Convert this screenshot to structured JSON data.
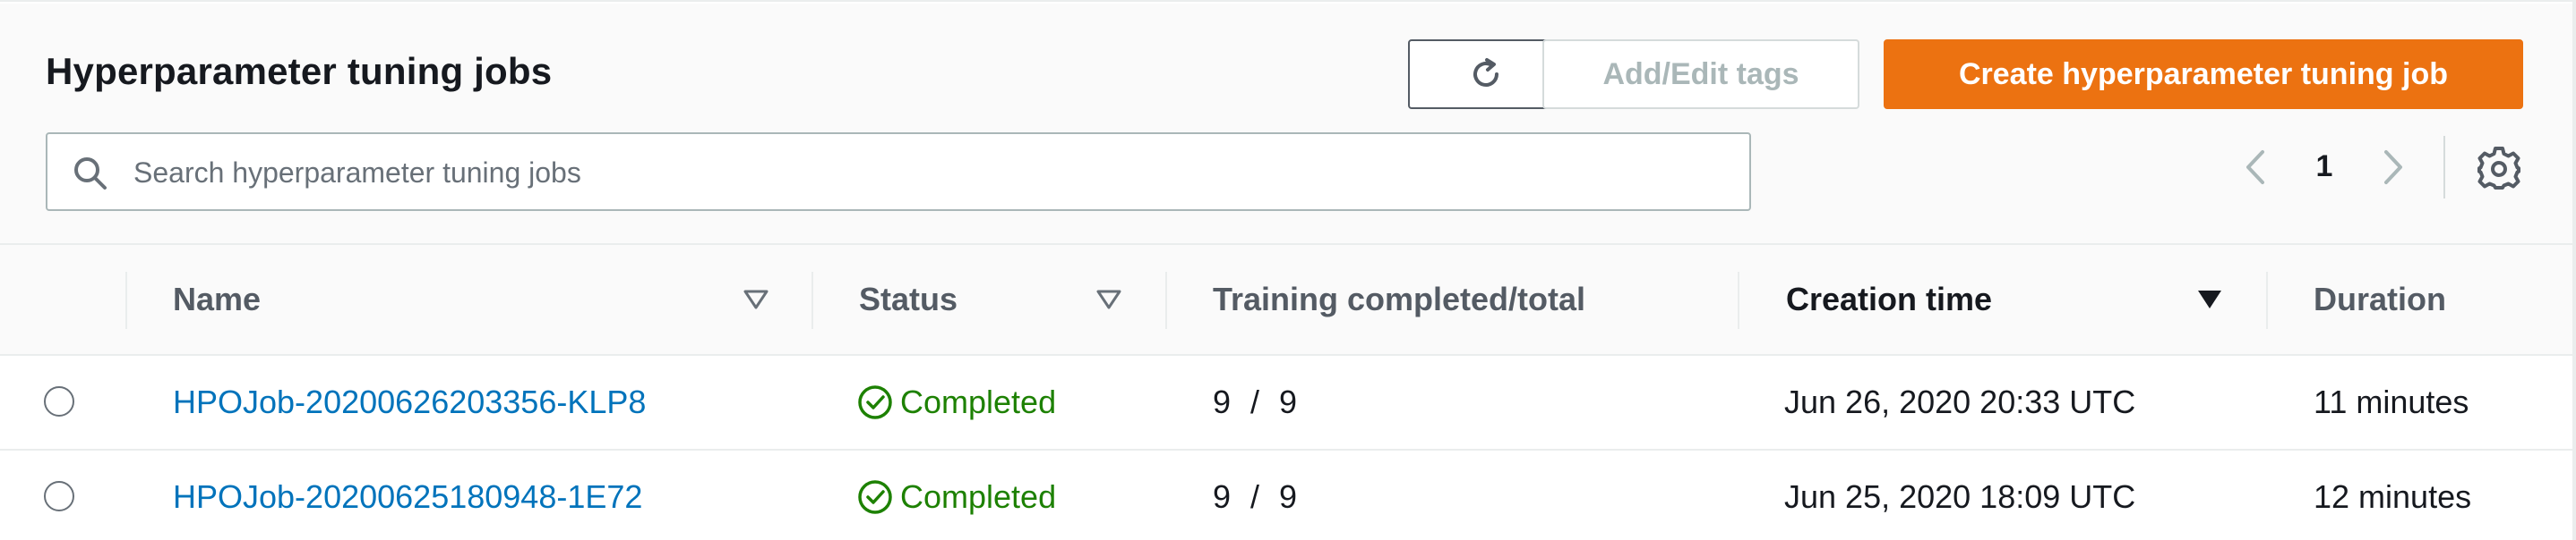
{
  "header": {
    "title": "Hyperparameter tuning jobs",
    "refresh_icon": "refresh-icon",
    "add_edit_tags_label": "Add/Edit tags",
    "create_label": "Create hyperparameter tuning job"
  },
  "search": {
    "placeholder": "Search hyperparameter tuning jobs",
    "value": "",
    "icon": "search-icon"
  },
  "pagination": {
    "current_page": "1",
    "prev_icon": "chevron-left-icon",
    "next_icon": "chevron-right-icon",
    "settings_icon": "gear-icon"
  },
  "table": {
    "columns": [
      {
        "label": "Name",
        "sort": "filter"
      },
      {
        "label": "Status",
        "sort": "filter"
      },
      {
        "label": "Training completed/total",
        "sort": "none"
      },
      {
        "label": "Creation time",
        "sort": "descending"
      },
      {
        "label": "Duration",
        "sort": "none"
      }
    ],
    "rows": [
      {
        "name": "HPOJob-20200626203356-KLP8",
        "status": "Completed",
        "completed": "9",
        "separator": "/",
        "total": "9",
        "creation_time": "Jun 26, 2020 20:33 UTC",
        "duration": "11 minutes"
      },
      {
        "name": "HPOJob-20200625180948-1E72",
        "status": "Completed",
        "completed": "9",
        "separator": "/",
        "total": "9",
        "creation_time": "Jun 25, 2020 18:09 UTC",
        "duration": "12 minutes"
      }
    ]
  },
  "colors": {
    "accent": "#ec7211",
    "link": "#0073bb",
    "success": "#1d8102",
    "border": "#eaeded"
  }
}
